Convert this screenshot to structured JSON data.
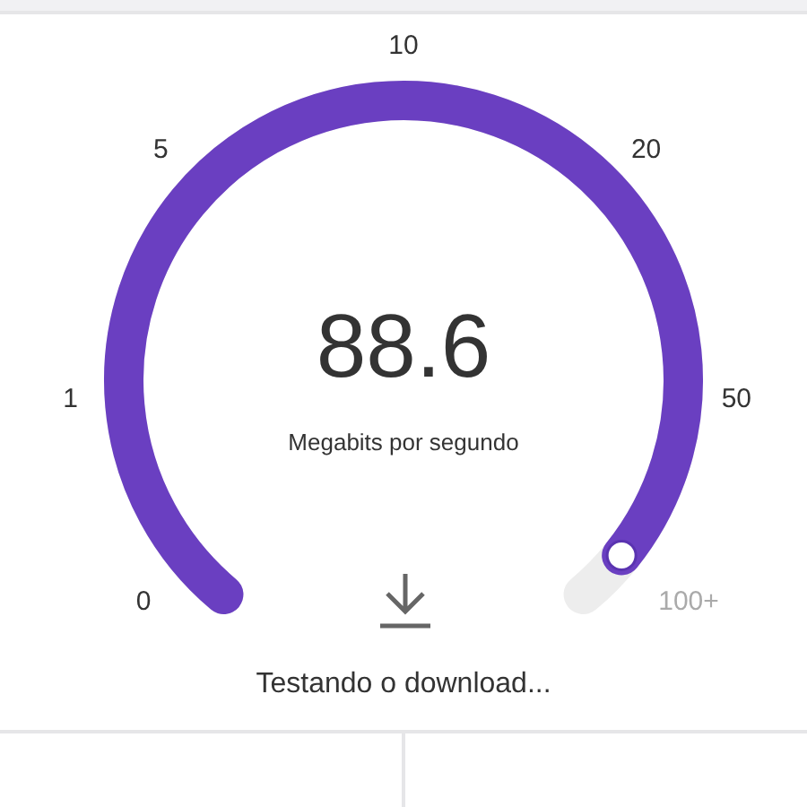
{
  "gauge": {
    "value": "88.6",
    "unit": "Megabits por segundo",
    "ticks": [
      {
        "label": "0",
        "reached": true
      },
      {
        "label": "1",
        "reached": true
      },
      {
        "label": "5",
        "reached": true
      },
      {
        "label": "10",
        "reached": true
      },
      {
        "label": "20",
        "reached": true
      },
      {
        "label": "50",
        "reached": true
      },
      {
        "label": "100+",
        "reached": false
      }
    ]
  },
  "status": "Testando o download..."
}
